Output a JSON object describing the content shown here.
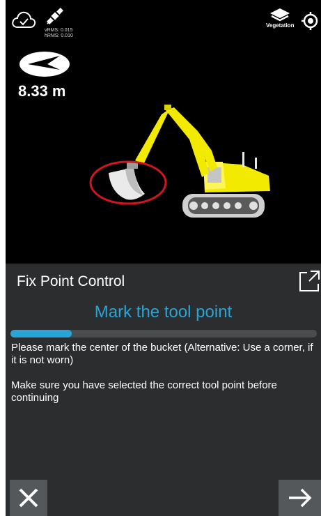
{
  "status": {
    "vrms_text": "vRMS: 0.015",
    "hrms_text": "hRMS: 0.010",
    "layer_label": "Vegetation",
    "distance_text": "8.33 m"
  },
  "panel": {
    "title": "Fix Point Control",
    "step_title": "Mark the tool point",
    "progress_fraction": 0.2,
    "instruction_1": "Please mark the center of the bucket (Alternative: Use a corner, if it is not worn)",
    "instruction_2": "Make sure you have selected the correct tool point before continuing"
  },
  "colors": {
    "accent": "#2aa4d4",
    "excavator": "#f2ea00",
    "highlight_ring": "#d0161c"
  },
  "icons": [
    "cloud-check-icon",
    "satellite-icon",
    "layers-icon",
    "locate-icon",
    "compass-arrow-icon",
    "popout-icon",
    "close-icon",
    "arrow-right-icon"
  ]
}
